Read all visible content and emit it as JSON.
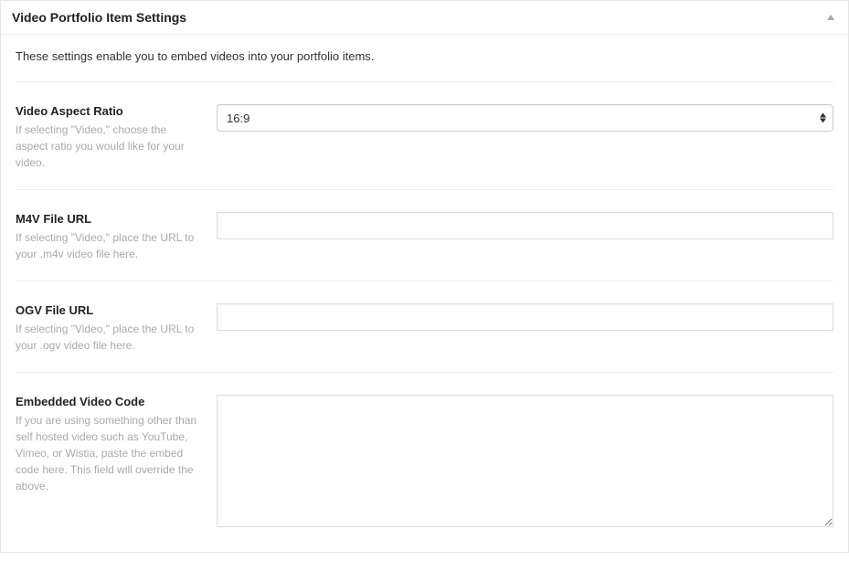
{
  "header": {
    "title": "Video Portfolio Item Settings"
  },
  "intro": "These settings enable you to embed videos into your portfolio items.",
  "fields": {
    "aspect_ratio": {
      "label": "Video Aspect Ratio",
      "desc": "If selecting \"Video,\" choose the aspect ratio you would like for your video.",
      "value": "16:9"
    },
    "m4v": {
      "label": "M4V File URL",
      "desc": "If selecting \"Video,\" place the URL to your .m4v video file here.",
      "value": ""
    },
    "ogv": {
      "label": "OGV File URL",
      "desc": "If selecting \"Video,\" place the URL to your .ogv video file here.",
      "value": ""
    },
    "embed": {
      "label": "Embedded Video Code",
      "desc": "If you are using something other than self hosted video such as YouTube, Vimeo, or Wistia, paste the embed code here. This field will override the above.",
      "value": ""
    }
  }
}
